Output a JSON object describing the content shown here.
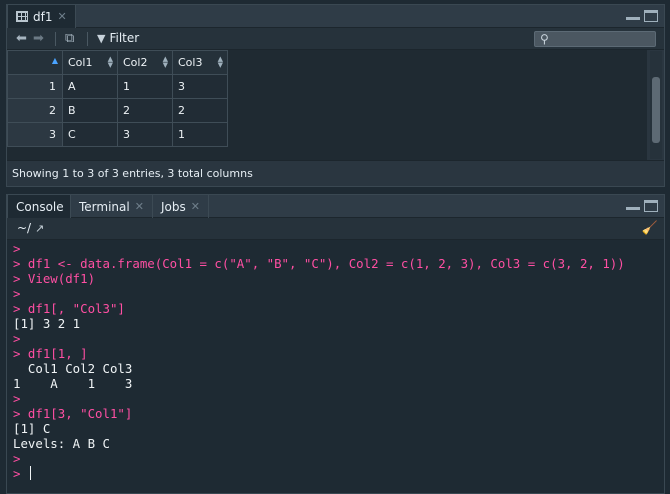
{
  "viewer": {
    "tab_label": "df1",
    "filter_label": "Filter",
    "columns": [
      "",
      "Col1",
      "Col2",
      "Col3"
    ],
    "rows": [
      [
        "1",
        "A",
        "1",
        "3"
      ],
      [
        "2",
        "B",
        "2",
        "2"
      ],
      [
        "3",
        "C",
        "3",
        "1"
      ]
    ],
    "status": "Showing 1 to 3 of 3 entries, 3 total columns"
  },
  "tabs": [
    {
      "label": "Console",
      "active": true
    },
    {
      "label": "Terminal",
      "active": false
    },
    {
      "label": "Jobs",
      "active": false
    }
  ],
  "console": {
    "path": "~/",
    "lines": [
      {
        "kind": "prompt",
        "text": "> "
      },
      {
        "kind": "cmd",
        "text": "> df1 <- data.frame(Col1 = c(\"A\", \"B\", \"C\"), Col2 = c(1, 2, 3), Col3 = c(3, 2, 1))"
      },
      {
        "kind": "cmd",
        "text": "> View(df1)"
      },
      {
        "kind": "prompt",
        "text": "> "
      },
      {
        "kind": "cmd",
        "text": "> df1[, \"Col3\"]"
      },
      {
        "kind": "out",
        "text": "[1] 3 2 1"
      },
      {
        "kind": "prompt",
        "text": "> "
      },
      {
        "kind": "cmd",
        "text": "> df1[1, ]"
      },
      {
        "kind": "out",
        "text": "  Col1 Col2 Col3"
      },
      {
        "kind": "out",
        "text": "1    A    1    3"
      },
      {
        "kind": "prompt",
        "text": "> "
      },
      {
        "kind": "cmd",
        "text": "> df1[3, \"Col1\"]"
      },
      {
        "kind": "out",
        "text": "[1] C"
      },
      {
        "kind": "out",
        "text": "Levels: A B C"
      },
      {
        "kind": "prompt",
        "text": "> "
      },
      {
        "kind": "input",
        "text": "> "
      }
    ]
  },
  "icons": {
    "back": "arrow-left-icon",
    "forward": "arrow-right-icon",
    "popout": "popout-icon",
    "filter": "filter-icon",
    "search": "search-icon",
    "minimize": "minimize-icon",
    "maximize": "maximize-icon",
    "broom": "clear-console-icon",
    "cursor": "text-cursor"
  },
  "colors": {
    "background": "#1e2a33",
    "prompt": "#ff4fa3",
    "text": "#f0f4f6",
    "sort_active": "#4aa3ff"
  }
}
